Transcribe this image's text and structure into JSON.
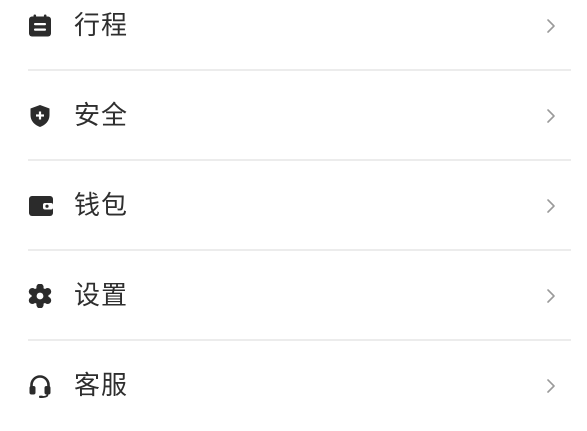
{
  "menu": {
    "items": [
      {
        "label": "行程",
        "icon": "itinerary-icon"
      },
      {
        "label": "安全",
        "icon": "shield-icon"
      },
      {
        "label": "钱包",
        "icon": "wallet-icon"
      },
      {
        "label": "设置",
        "icon": "gear-icon"
      },
      {
        "label": "客服",
        "icon": "headset-icon"
      }
    ]
  },
  "colors": {
    "icon": "#2b2b2b",
    "text": "#2e2e2e",
    "chevron": "#9a9a9a",
    "divider": "#ececec",
    "background": "#ffffff"
  }
}
